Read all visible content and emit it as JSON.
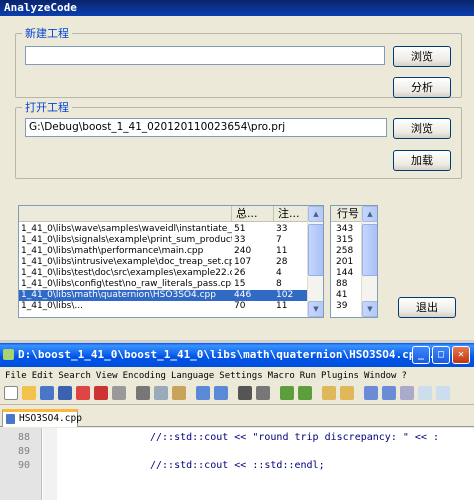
{
  "app": {
    "title": "AnalyzeCode"
  },
  "new_project": {
    "label": "新建工程",
    "path_value": "",
    "browse_label": "浏览",
    "analyze_label": "分析"
  },
  "open_project": {
    "label": "打开工程",
    "path_value": "G:\\Debug\\boost_1_41_020120110023654\\pro.prj",
    "browse_label": "浏览",
    "load_label": "加载"
  },
  "file_list": {
    "columns": [
      "",
      "总...",
      "注..."
    ],
    "rows": [
      [
        "1_41_0\\libs\\wave\\samples\\waveidl\\instantiate_re2c...",
        "51",
        "33"
      ],
      [
        "1_41_0\\libs\\signals\\example\\print_sum_product.cpp",
        "33",
        "7"
      ],
      [
        "1_41_0\\libs\\math\\performance\\main.cpp",
        "240",
        "11"
      ],
      [
        "1_41_0\\libs\\intrusive\\example\\doc_treap_set.cpp",
        "107",
        "28"
      ],
      [
        "1_41_0\\libs\\test\\doc\\src\\examples\\example22.cpp",
        "26",
        "4"
      ],
      [
        "1_41_0\\libs\\config\\test\\no_raw_literals_pass.cpp",
        "15",
        "8"
      ],
      [
        "1_41_0\\libs\\math\\quaternion\\HSO3SO4.cpp",
        "446",
        "102"
      ],
      [
        "1_41_0\\libs\\...",
        "70",
        "11"
      ]
    ],
    "selected_index": 6
  },
  "line_list": {
    "header": "行号",
    "values": [
      "343",
      "315",
      "258",
      "201",
      "144",
      "88",
      "41",
      "39"
    ]
  },
  "exit_label": "退出",
  "npp": {
    "title": "D:\\boost_1_41_0\\boost_1_41_0\\libs\\math\\quaternion\\HSO3SO4.cpp...",
    "menu": [
      "File",
      "Edit",
      "Search",
      "View",
      "Encoding",
      "Language",
      "Settings",
      "Macro",
      "Run",
      "Plugins",
      "Window",
      "?"
    ],
    "tab": "HSO3SO4.cpp",
    "lines": [
      {
        "num": "88",
        "code": "//::std::cout << \"round trip discrepancy: \" << :"
      },
      {
        "num": "89",
        "code": ""
      },
      {
        "num": "90",
        "code": "//::std::cout << ::std::endl;"
      }
    ]
  }
}
